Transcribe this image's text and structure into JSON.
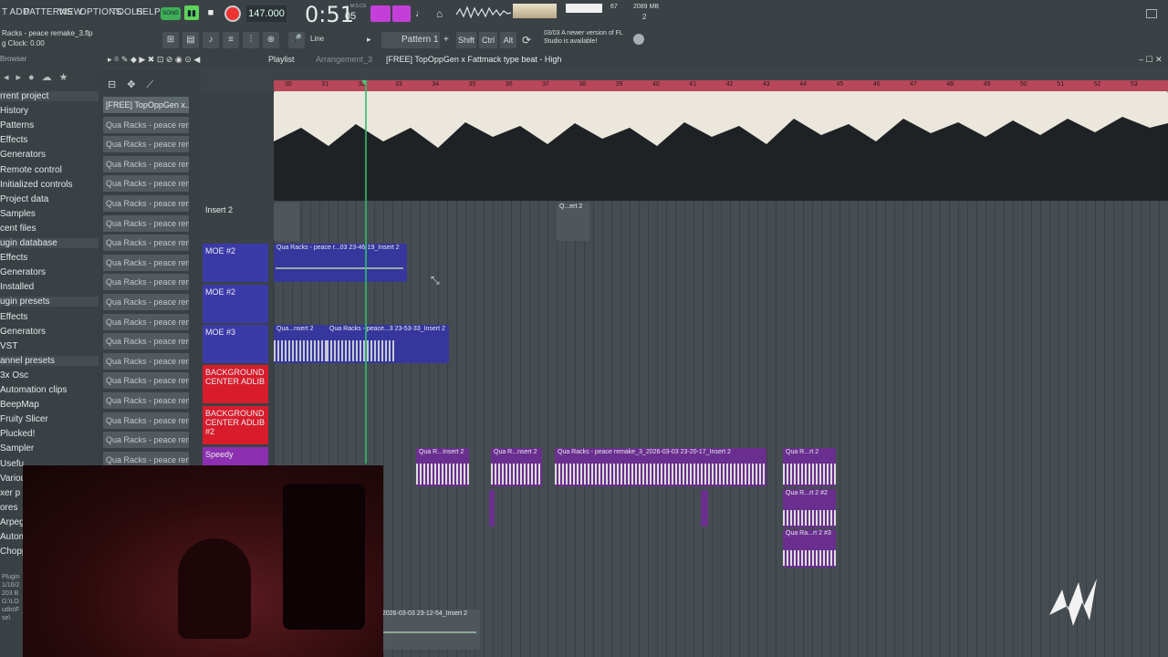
{
  "menu": [
    "T ADD",
    "PATTERNS",
    "VIEW",
    "OPTIONS",
    "TOOLS",
    "HELP"
  ],
  "transport": {
    "song_badge": "SONG",
    "tempo": "147.000",
    "time": "0:51",
    "time_sub": "05",
    "time_label": "M:S:CS",
    "cpu": "67",
    "memory": "2089 MB",
    "voices": "2",
    "pattern": "Pattern 1",
    "snap": "Line",
    "shift": "Shift",
    "ctrl": "Ctrl",
    "alt": "Alt",
    "news": "03/03  A newer version of FL Studio is available!"
  },
  "window": {
    "title_file": "Racks - peace remake_3.flp",
    "clock": "g Clock: 0.00"
  },
  "playlist_header": {
    "label": "Playlist",
    "arrangement": "Arrangement_3",
    "title": "[FREE] TopOppGen x Fattmack type beat - High"
  },
  "browser": {
    "label": "Browser",
    "items": [
      {
        "label": "rrent project",
        "head": true
      },
      {
        "label": "History"
      },
      {
        "label": "Patterns"
      },
      {
        "label": "Effects"
      },
      {
        "label": "Generators"
      },
      {
        "label": "Remote control"
      },
      {
        "label": "Initialized controls"
      },
      {
        "label": "Project data"
      },
      {
        "label": "Samples"
      },
      {
        "label": "cent files"
      },
      {
        "label": "ugin database",
        "head": true
      },
      {
        "label": "Effects"
      },
      {
        "label": "Generators"
      },
      {
        "label": "Installed"
      },
      {
        "label": "ugin presets",
        "head": true
      },
      {
        "label": "Effects"
      },
      {
        "label": "Generators"
      },
      {
        "label": "VST"
      },
      {
        "label": "annel presets",
        "head": true
      },
      {
        "label": "3x Osc"
      },
      {
        "label": "Automation clips"
      },
      {
        "label": "BeepMap"
      },
      {
        "label": "Fruity Slicer"
      },
      {
        "label": "Plucked!"
      },
      {
        "label": "Sampler"
      },
      {
        "label": "Usefu"
      },
      {
        "label": "Variou"
      },
      {
        "label": "xer p"
      },
      {
        "label": "ores"
      },
      {
        "label": "Arpeg"
      },
      {
        "label": "Autom"
      },
      {
        "label": "Chopp"
      }
    ],
    "status": [
      "Plugin",
      "1/16/2",
      "203 B",
      "G:\\LO",
      "udio\\F",
      "se\\"
    ]
  },
  "channels": [
    "[FREE] TopOppGen x...",
    "Qua Racks - peace remak",
    "Qua Racks - peace remak",
    "Qua Racks - peace remak",
    "Qua Racks - peace remak",
    "Qua Racks - peace remak",
    "Qua Racks - peace remak",
    "Qua Racks - peace remak",
    "Qua Racks - peace remak",
    "Qua Racks - peace remak",
    "Qua Racks - peace remak",
    "Qua Racks - peace remak",
    "Qua Racks - peace remak",
    "Qua Racks - peace remak",
    "Qua Racks - peace remak",
    "Qua Racks - peace remak",
    "Qua Racks - peace remak",
    "Qua Racks - peace remak",
    "Qua Racks - peace remak",
    "Qua Racks - peace remak"
  ],
  "tracks": [
    {
      "name": "Insert 2",
      "color": "#3b4246"
    },
    {
      "name": "MOE #2",
      "color": "#3a3aa8"
    },
    {
      "name": "MOE #2",
      "color": "#3a3aa8"
    },
    {
      "name": "MOE #3",
      "color": "#3a3aa8"
    },
    {
      "name": "BACKGROUND CENTER ADLIB",
      "color": "#d81c2c"
    },
    {
      "name": "BACKGROUND CENTER ADLIB #2",
      "color": "#d81c2c"
    },
    {
      "name": "Speedy",
      "color": "#8c2fb0"
    }
  ],
  "ruler": [
    "30",
    "31",
    "32",
    "33",
    "34",
    "35",
    "36",
    "37",
    "38",
    "39",
    "40",
    "41",
    "42",
    "43",
    "44",
    "45",
    "46",
    "47",
    "48",
    "49",
    "50",
    "51",
    "52",
    "53"
  ],
  "clips": [
    {
      "label": "Q...ert 2"
    },
    {
      "label": "Qua Racks - peace r...03 23-46-19_Insert 2"
    },
    {
      "label": "Qua...nsert 2"
    },
    {
      "label": "Qua Racks - peace...3 23-53-33_Insert 2"
    },
    {
      "label": "Qua R...Insert 2"
    },
    {
      "label": "Qua R...nsert 2"
    },
    {
      "label": "Qua Racks - peace remake_3_2026-03-03 23-20-17_Insert 2"
    },
    {
      "label": "Qua R...rt 2"
    },
    {
      "label": "Qua R...rt 2 #2"
    },
    {
      "label": "Qua Ra...rt 2 #3"
    },
    {
      "label": "2026-03-03 23-12-54_Insert 2"
    }
  ]
}
